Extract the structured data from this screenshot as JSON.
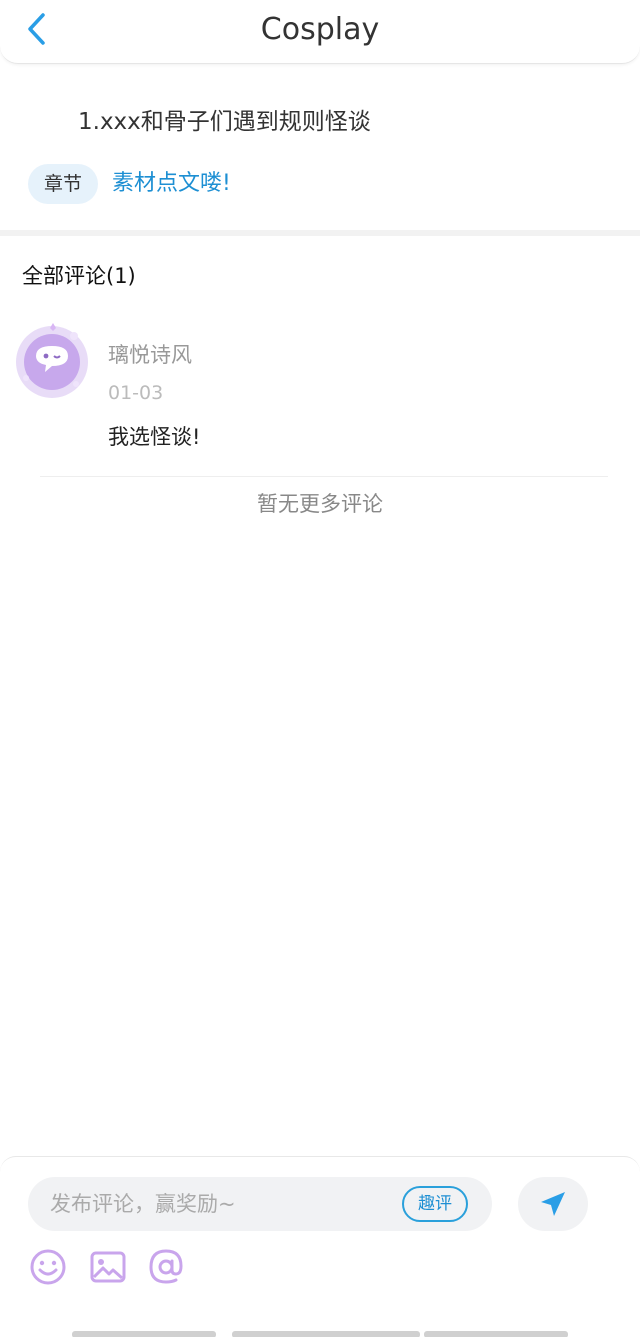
{
  "header": {
    "title": "Cosplay"
  },
  "post": {
    "title": "1.xxx和骨子们遇到规则怪谈",
    "tag": "章节",
    "tag_link": "素材点文喽!"
  },
  "comments_section": {
    "title": "全部评论(1)",
    "comments": [
      {
        "name": "璃悦诗风",
        "date": "01-03",
        "text": "我选怪谈!"
      }
    ],
    "no_more": "暂无更多评论"
  },
  "composer": {
    "placeholder": "发布评论，赢奖励~",
    "badge": "趣评"
  },
  "colors": {
    "accent": "#1d8fd3",
    "tool_purple": "#c9a5ec"
  }
}
